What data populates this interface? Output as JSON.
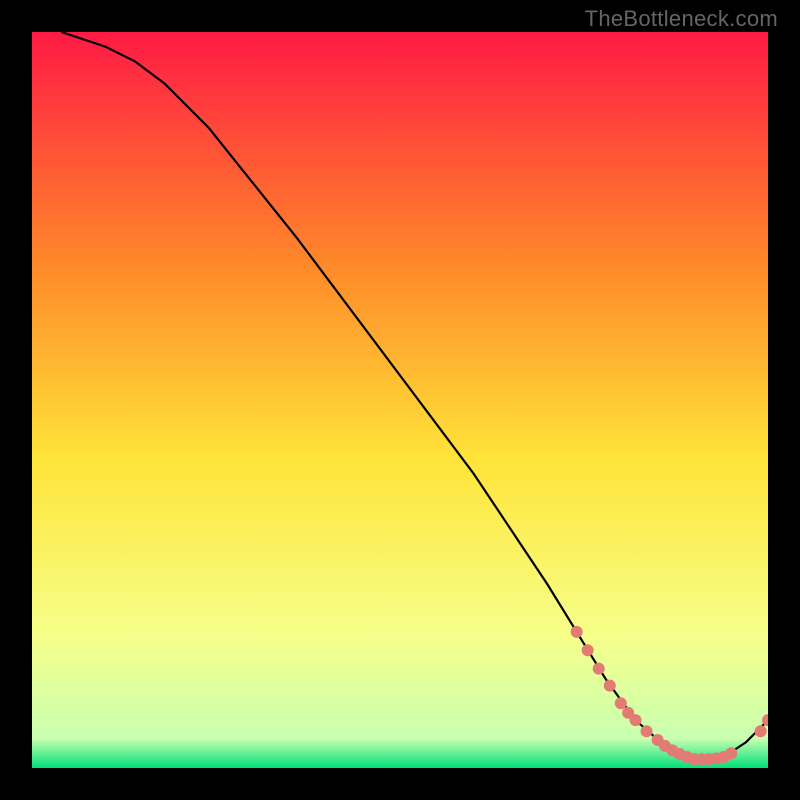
{
  "watermark": "TheBottleneck.com",
  "colors": {
    "bg": "#000000",
    "gradient_top": "#ff1a44",
    "gradient_upper_mid": "#ff8a2a",
    "gradient_mid": "#ffe438",
    "gradient_lower_mid": "#f6ff8a",
    "gradient_bottom": "#00e07a",
    "curve": "#000000",
    "dots": "#e47a74"
  },
  "chart_data": {
    "type": "line",
    "title": "",
    "xlabel": "",
    "ylabel": "",
    "xlim": [
      0,
      100
    ],
    "ylim": [
      0,
      100
    ],
    "curve": {
      "x": [
        4,
        7,
        10,
        14,
        18,
        24,
        30,
        36,
        42,
        48,
        54,
        60,
        66,
        70,
        74,
        78,
        82,
        86,
        90,
        94,
        97,
        100
      ],
      "y": [
        100,
        99,
        98,
        96,
        93,
        87,
        79.5,
        72,
        64,
        56,
        48,
        40,
        31,
        25,
        18.5,
        12,
        6.5,
        3,
        1.2,
        1.5,
        3.5,
        6.5
      ]
    },
    "series": [
      {
        "name": "dots",
        "type": "scatter",
        "x": [
          74,
          75.5,
          77,
          78.5,
          80,
          81,
          82,
          83.5,
          85,
          86,
          87,
          88,
          89,
          90,
          91,
          92,
          93,
          94,
          95,
          99,
          100
        ],
        "y": [
          18.5,
          16,
          13.5,
          11.2,
          8.8,
          7.5,
          6.5,
          5.0,
          3.8,
          3.0,
          2.4,
          1.9,
          1.5,
          1.2,
          1.2,
          1.2,
          1.3,
          1.5,
          2.0,
          5.0,
          6.5
        ]
      }
    ]
  }
}
